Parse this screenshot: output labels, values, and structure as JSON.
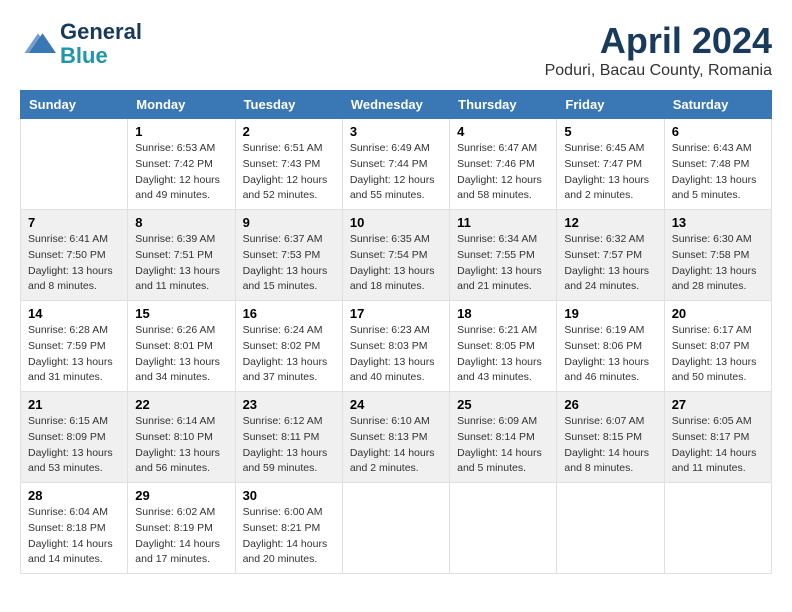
{
  "header": {
    "logo_line1": "General",
    "logo_line2": "Blue",
    "month_title": "April 2024",
    "subtitle": "Poduri, Bacau County, Romania"
  },
  "weekdays": [
    "Sunday",
    "Monday",
    "Tuesday",
    "Wednesday",
    "Thursday",
    "Friday",
    "Saturday"
  ],
  "weeks": [
    [
      {
        "day": "",
        "sunrise": "",
        "sunset": "",
        "daylight": ""
      },
      {
        "day": "1",
        "sunrise": "Sunrise: 6:53 AM",
        "sunset": "Sunset: 7:42 PM",
        "daylight": "Daylight: 12 hours and 49 minutes."
      },
      {
        "day": "2",
        "sunrise": "Sunrise: 6:51 AM",
        "sunset": "Sunset: 7:43 PM",
        "daylight": "Daylight: 12 hours and 52 minutes."
      },
      {
        "day": "3",
        "sunrise": "Sunrise: 6:49 AM",
        "sunset": "Sunset: 7:44 PM",
        "daylight": "Daylight: 12 hours and 55 minutes."
      },
      {
        "day": "4",
        "sunrise": "Sunrise: 6:47 AM",
        "sunset": "Sunset: 7:46 PM",
        "daylight": "Daylight: 12 hours and 58 minutes."
      },
      {
        "day": "5",
        "sunrise": "Sunrise: 6:45 AM",
        "sunset": "Sunset: 7:47 PM",
        "daylight": "Daylight: 13 hours and 2 minutes."
      },
      {
        "day": "6",
        "sunrise": "Sunrise: 6:43 AM",
        "sunset": "Sunset: 7:48 PM",
        "daylight": "Daylight: 13 hours and 5 minutes."
      }
    ],
    [
      {
        "day": "7",
        "sunrise": "Sunrise: 6:41 AM",
        "sunset": "Sunset: 7:50 PM",
        "daylight": "Daylight: 13 hours and 8 minutes."
      },
      {
        "day": "8",
        "sunrise": "Sunrise: 6:39 AM",
        "sunset": "Sunset: 7:51 PM",
        "daylight": "Daylight: 13 hours and 11 minutes."
      },
      {
        "day": "9",
        "sunrise": "Sunrise: 6:37 AM",
        "sunset": "Sunset: 7:53 PM",
        "daylight": "Daylight: 13 hours and 15 minutes."
      },
      {
        "day": "10",
        "sunrise": "Sunrise: 6:35 AM",
        "sunset": "Sunset: 7:54 PM",
        "daylight": "Daylight: 13 hours and 18 minutes."
      },
      {
        "day": "11",
        "sunrise": "Sunrise: 6:34 AM",
        "sunset": "Sunset: 7:55 PM",
        "daylight": "Daylight: 13 hours and 21 minutes."
      },
      {
        "day": "12",
        "sunrise": "Sunrise: 6:32 AM",
        "sunset": "Sunset: 7:57 PM",
        "daylight": "Daylight: 13 hours and 24 minutes."
      },
      {
        "day": "13",
        "sunrise": "Sunrise: 6:30 AM",
        "sunset": "Sunset: 7:58 PM",
        "daylight": "Daylight: 13 hours and 28 minutes."
      }
    ],
    [
      {
        "day": "14",
        "sunrise": "Sunrise: 6:28 AM",
        "sunset": "Sunset: 7:59 PM",
        "daylight": "Daylight: 13 hours and 31 minutes."
      },
      {
        "day": "15",
        "sunrise": "Sunrise: 6:26 AM",
        "sunset": "Sunset: 8:01 PM",
        "daylight": "Daylight: 13 hours and 34 minutes."
      },
      {
        "day": "16",
        "sunrise": "Sunrise: 6:24 AM",
        "sunset": "Sunset: 8:02 PM",
        "daylight": "Daylight: 13 hours and 37 minutes."
      },
      {
        "day": "17",
        "sunrise": "Sunrise: 6:23 AM",
        "sunset": "Sunset: 8:03 PM",
        "daylight": "Daylight: 13 hours and 40 minutes."
      },
      {
        "day": "18",
        "sunrise": "Sunrise: 6:21 AM",
        "sunset": "Sunset: 8:05 PM",
        "daylight": "Daylight: 13 hours and 43 minutes."
      },
      {
        "day": "19",
        "sunrise": "Sunrise: 6:19 AM",
        "sunset": "Sunset: 8:06 PM",
        "daylight": "Daylight: 13 hours and 46 minutes."
      },
      {
        "day": "20",
        "sunrise": "Sunrise: 6:17 AM",
        "sunset": "Sunset: 8:07 PM",
        "daylight": "Daylight: 13 hours and 50 minutes."
      }
    ],
    [
      {
        "day": "21",
        "sunrise": "Sunrise: 6:15 AM",
        "sunset": "Sunset: 8:09 PM",
        "daylight": "Daylight: 13 hours and 53 minutes."
      },
      {
        "day": "22",
        "sunrise": "Sunrise: 6:14 AM",
        "sunset": "Sunset: 8:10 PM",
        "daylight": "Daylight: 13 hours and 56 minutes."
      },
      {
        "day": "23",
        "sunrise": "Sunrise: 6:12 AM",
        "sunset": "Sunset: 8:11 PM",
        "daylight": "Daylight: 13 hours and 59 minutes."
      },
      {
        "day": "24",
        "sunrise": "Sunrise: 6:10 AM",
        "sunset": "Sunset: 8:13 PM",
        "daylight": "Daylight: 14 hours and 2 minutes."
      },
      {
        "day": "25",
        "sunrise": "Sunrise: 6:09 AM",
        "sunset": "Sunset: 8:14 PM",
        "daylight": "Daylight: 14 hours and 5 minutes."
      },
      {
        "day": "26",
        "sunrise": "Sunrise: 6:07 AM",
        "sunset": "Sunset: 8:15 PM",
        "daylight": "Daylight: 14 hours and 8 minutes."
      },
      {
        "day": "27",
        "sunrise": "Sunrise: 6:05 AM",
        "sunset": "Sunset: 8:17 PM",
        "daylight": "Daylight: 14 hours and 11 minutes."
      }
    ],
    [
      {
        "day": "28",
        "sunrise": "Sunrise: 6:04 AM",
        "sunset": "Sunset: 8:18 PM",
        "daylight": "Daylight: 14 hours and 14 minutes."
      },
      {
        "day": "29",
        "sunrise": "Sunrise: 6:02 AM",
        "sunset": "Sunset: 8:19 PM",
        "daylight": "Daylight: 14 hours and 17 minutes."
      },
      {
        "day": "30",
        "sunrise": "Sunrise: 6:00 AM",
        "sunset": "Sunset: 8:21 PM",
        "daylight": "Daylight: 14 hours and 20 minutes."
      },
      {
        "day": "",
        "sunrise": "",
        "sunset": "",
        "daylight": ""
      },
      {
        "day": "",
        "sunrise": "",
        "sunset": "",
        "daylight": ""
      },
      {
        "day": "",
        "sunrise": "",
        "sunset": "",
        "daylight": ""
      },
      {
        "day": "",
        "sunrise": "",
        "sunset": "",
        "daylight": ""
      }
    ]
  ]
}
